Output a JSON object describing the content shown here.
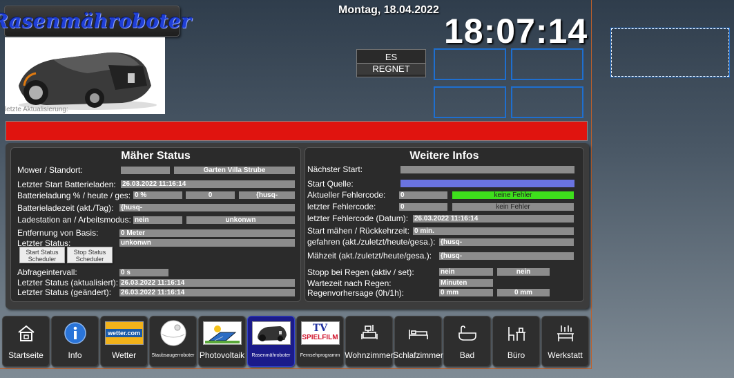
{
  "header": {
    "title": "Rasenmähroboter",
    "last_update_label": "letzte Aktualisierung:",
    "date": "Montag, 18.04.2022",
    "time": "18:07:14",
    "rain_button": {
      "line1": "ES",
      "line2": "REGNET"
    }
  },
  "colors": {
    "alert_bar": "#e0140f",
    "accent_blue": "#1e6fd0",
    "ok_green": "#3ee01c",
    "source_blue": "#6a73e0"
  },
  "maeher_status": {
    "title": "Mäher Status",
    "mower_location_label": "Mower / Standort:",
    "mower_location_value": "Garten Villa Strube",
    "last_charge_start_label": "Letzter Start Batterieladen:",
    "last_charge_start_value": "26.03.2022 11:16:14",
    "battery_label": "Batterieladung % / heute / ges:",
    "battery_percent": "0 %",
    "battery_today": "0",
    "battery_total": "{husq-",
    "charge_time_label": "Batterieladezeit (akt./Tag):",
    "charge_time_value": "{husq-",
    "charging_station_label": "Ladestation an / Arbeitsmodus:",
    "charging_station_value": "nein",
    "work_mode_value": "unkonwn",
    "distance_label": "Entfernung von Basis:",
    "distance_value": "0 Meter",
    "last_status_label": "Letzter Status:",
    "last_status_value": "unkonwn",
    "start_scheduler_label": "Start Status Scheduler",
    "stop_scheduler_label": "Stop Status Scheduler",
    "poll_interval_label": "Abfrageintervall:",
    "poll_interval_value": "0 s",
    "status_updated_label": "Letzter Status (aktualisiert):",
    "status_updated_value": "26.03.2022 11:16:14",
    "status_changed_label": "Letzter Status (geändert):",
    "status_changed_value": "26.03.2022 11:16:14"
  },
  "weitere_infos": {
    "title": "Weitere Infos",
    "next_start_label": "Nächster Start:",
    "start_source_label": "Start Quelle:",
    "error_code_label": "Aktueller Fehlercode:",
    "error_code_value": "0",
    "error_code_text": "keine Fehler",
    "last_error_code_label": "letzter Fehlercode:",
    "last_error_code_value": "0",
    "last_error_code_text": "kein Fehler",
    "last_error_date_label": "letzter Fehlercode (Datum):",
    "last_error_date_value": "26.03.2022 11:16:14",
    "mow_start_label": "Start mähen / Rückkehrzeit:",
    "mow_start_value": "0 min.",
    "driven_label": "gefahren (akt./zuletzt/heute/gesa.):",
    "driven_value": "{husq-",
    "mow_time_label": "Mähzeit (akt./zuletzt/heute/gesa.):",
    "mow_time_value": "{husq-",
    "rain_stop_label": "Stopp bei Regen (aktiv / set):",
    "rain_stop_active": "nein",
    "rain_stop_set": "nein",
    "rain_wait_label": "Wartezeit nach Regen:",
    "rain_wait_value": "Minuten",
    "rain_forecast_label": "Regenvorhersage (0h/1h):",
    "rain_forecast_0h": "0 mm",
    "rain_forecast_1h": "0 mm"
  },
  "nav": [
    {
      "label": "Startseite",
      "icon": "home-icon"
    },
    {
      "label": "Info",
      "icon": "info-icon"
    },
    {
      "label": "Wetter",
      "icon": "wetter-logo",
      "logo_text": "wetter.com"
    },
    {
      "label": "Staubsaugerroboter",
      "icon": "vacuum-robot-icon"
    },
    {
      "label": "Photovoltaik",
      "icon": "solar-panel-icon"
    },
    {
      "label": "Rasenmähroboter",
      "icon": "lawnmower-icon"
    },
    {
      "label": "Fernsehprogramm",
      "icon": "tv-spielfilm-logo",
      "logo_text_1": "TV",
      "logo_text_2": "SPIELFILM"
    },
    {
      "label": "Wohnzimmer",
      "icon": "living-room-icon"
    },
    {
      "label": "Schlafzimmer",
      "icon": "bed-icon"
    },
    {
      "label": "Bad",
      "icon": "bathtub-icon"
    },
    {
      "label": "Büro",
      "icon": "desk-icon"
    },
    {
      "label": "Werkstatt",
      "icon": "workbench-icon"
    }
  ]
}
